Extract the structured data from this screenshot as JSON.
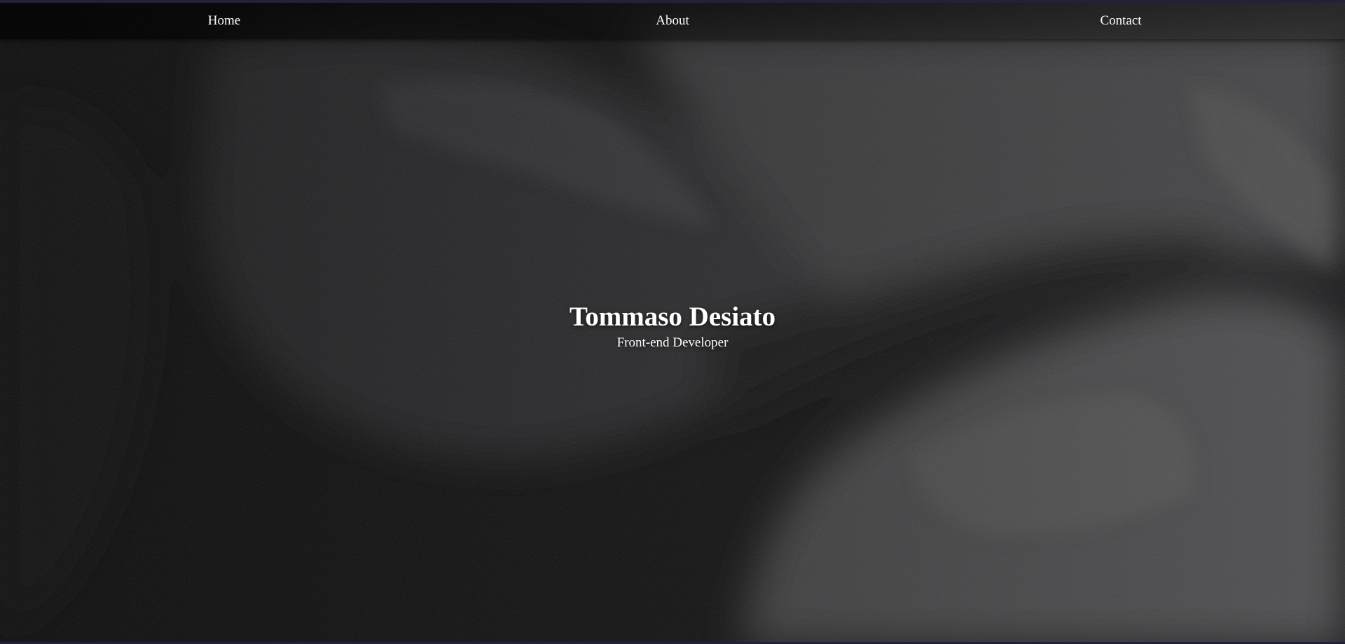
{
  "nav": {
    "items": [
      {
        "label": "Home"
      },
      {
        "label": "About"
      },
      {
        "label": "Contact"
      }
    ]
  },
  "hero": {
    "title": "Tommaso Desiato",
    "subtitle": "Front-end Developer"
  },
  "colors": {
    "text": "#ffffff",
    "background": "#0b0b0e",
    "frame": "#23213a"
  }
}
